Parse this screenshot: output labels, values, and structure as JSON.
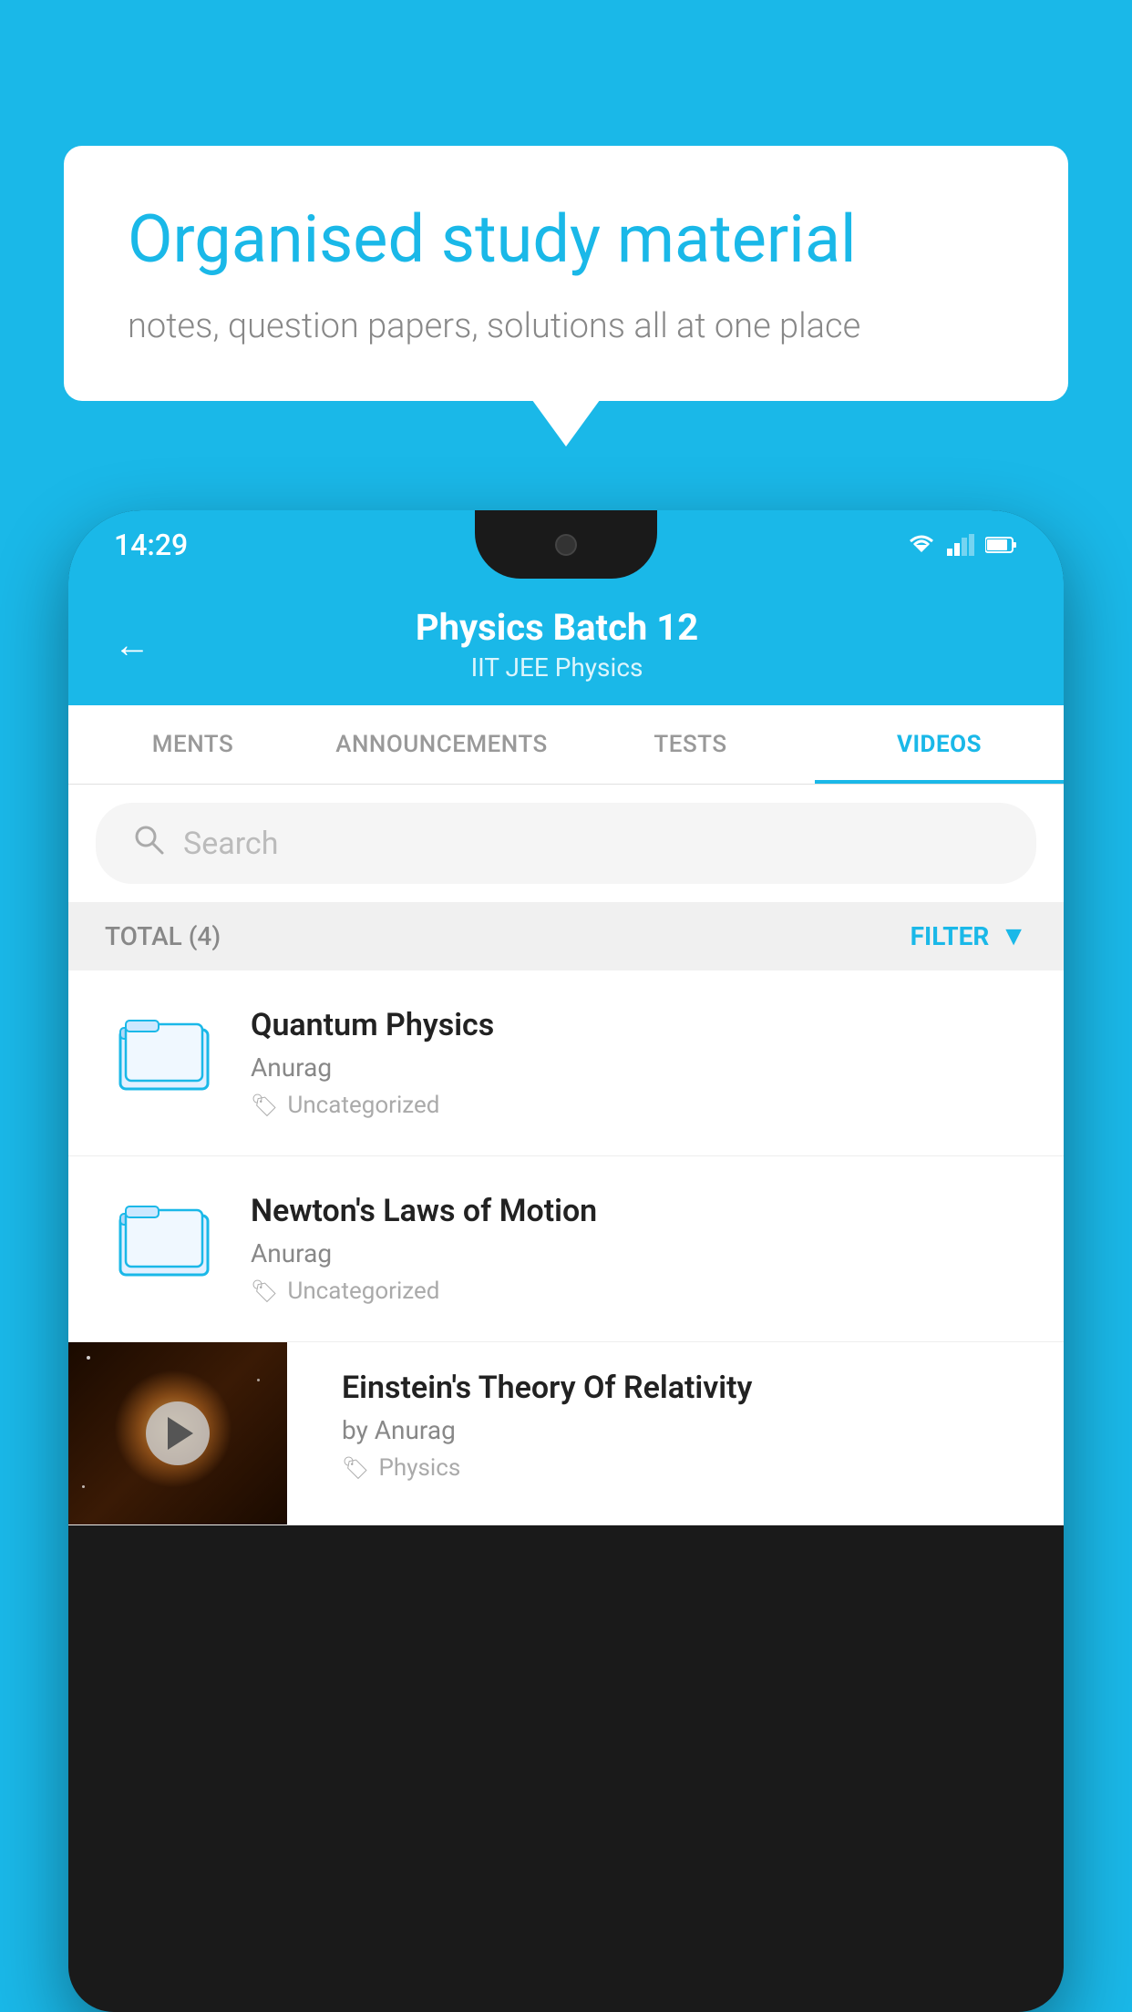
{
  "background_color": "#1ab8e8",
  "speech_bubble": {
    "headline": "Organised study material",
    "subtext": "notes, question papers, solutions all at one place"
  },
  "phone": {
    "status_bar": {
      "time": "14:29"
    },
    "header": {
      "back_label": "←",
      "title": "Physics Batch 12",
      "subtitle": "IIT JEE   Physics"
    },
    "tabs": [
      {
        "label": "MENTS",
        "active": false
      },
      {
        "label": "ANNOUNCEMENTS",
        "active": false
      },
      {
        "label": "TESTS",
        "active": false
      },
      {
        "label": "VIDEOS",
        "active": true
      }
    ],
    "search": {
      "placeholder": "Search"
    },
    "filter_bar": {
      "total_label": "TOTAL (4)",
      "filter_label": "FILTER"
    },
    "videos": [
      {
        "title": "Quantum Physics",
        "author": "Anurag",
        "tag": "Uncategorized",
        "has_thumbnail": false
      },
      {
        "title": "Newton's Laws of Motion",
        "author": "Anurag",
        "tag": "Uncategorized",
        "has_thumbnail": false
      },
      {
        "title": "Einstein's Theory Of Relativity",
        "author": "by Anurag",
        "tag": "Physics",
        "has_thumbnail": true
      }
    ]
  }
}
